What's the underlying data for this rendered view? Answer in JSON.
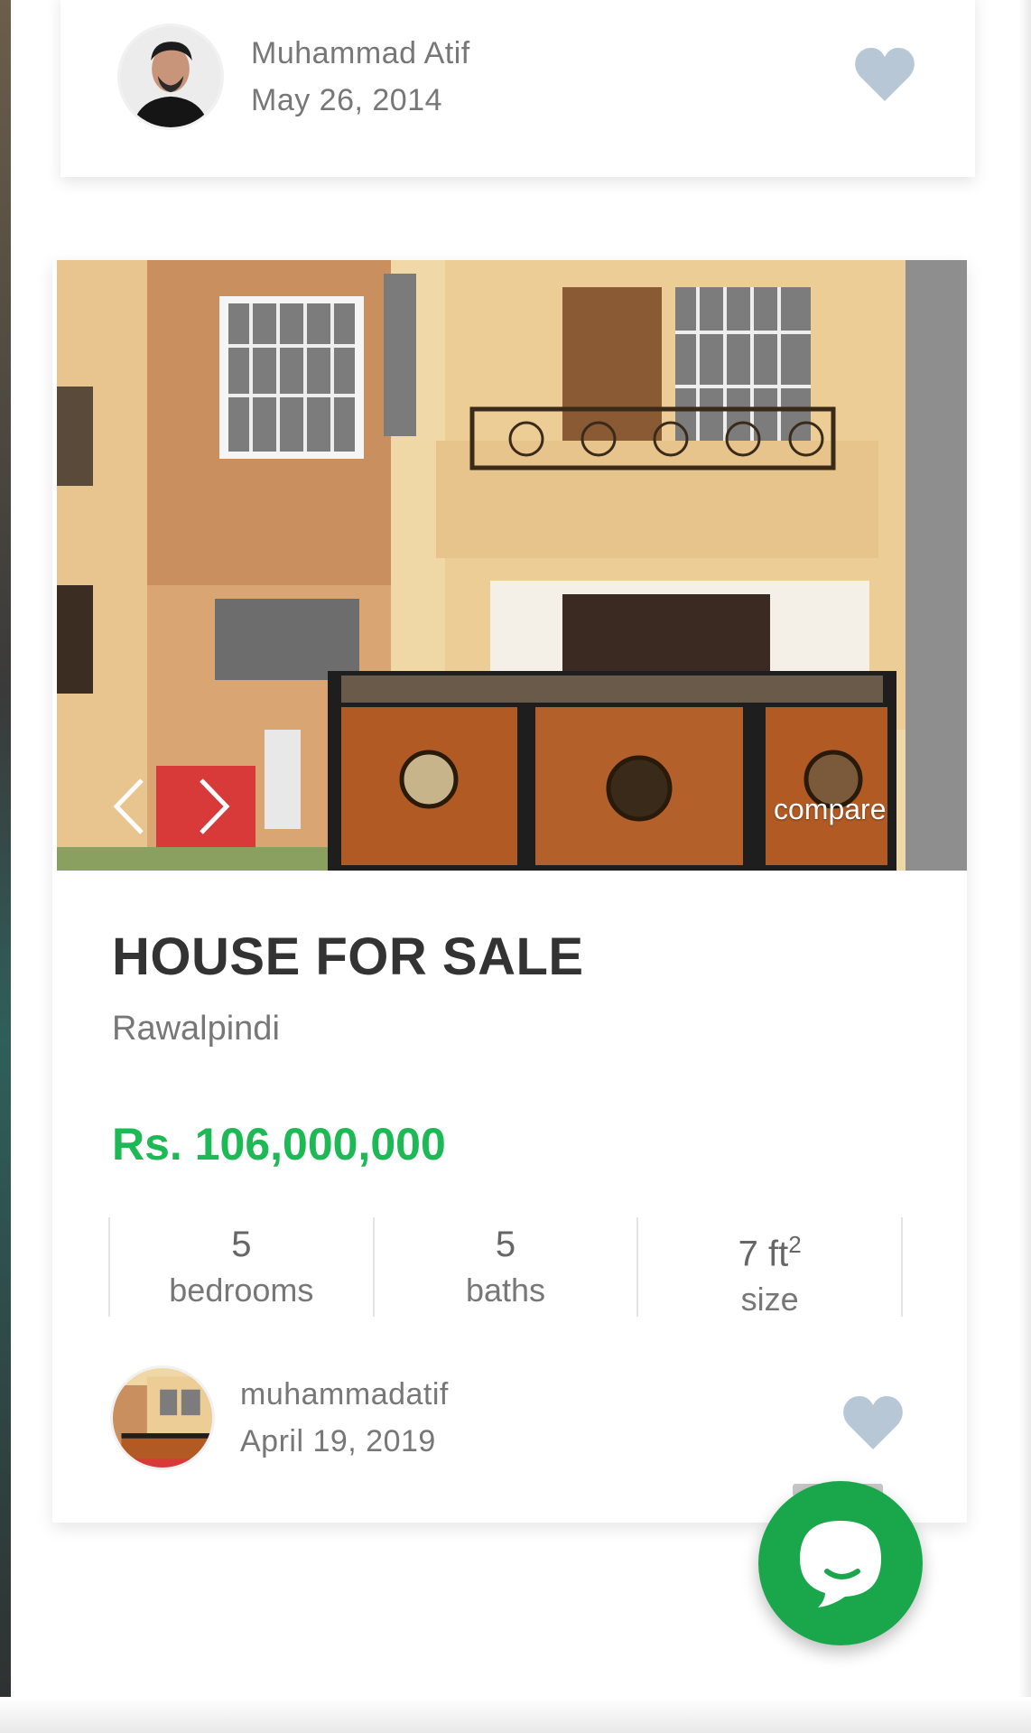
{
  "top_card": {
    "author_name": "Muhammad Atif",
    "author_date": "May 26, 2014"
  },
  "listing": {
    "title": "HOUSE FOR SALE",
    "location": "Rawalpindi",
    "price": "Rs. 106,000,000",
    "compare_label": "compare",
    "stats": [
      {
        "value": "5",
        "label": "bedrooms"
      },
      {
        "value": "5",
        "label": "baths"
      },
      {
        "value": "7 ft",
        "sup": "2",
        "label": "size"
      }
    ],
    "author_name": "muhammadatif",
    "author_date": "April 19, 2019"
  },
  "icons": {
    "favorite": "heart-icon",
    "prev": "chevron-left-icon",
    "next": "chevron-right-icon",
    "chat": "chat-bubble-icon"
  },
  "colors": {
    "price": "#1db954",
    "heart": "#b8c7d6",
    "chat_fab": "#1aa64a"
  }
}
